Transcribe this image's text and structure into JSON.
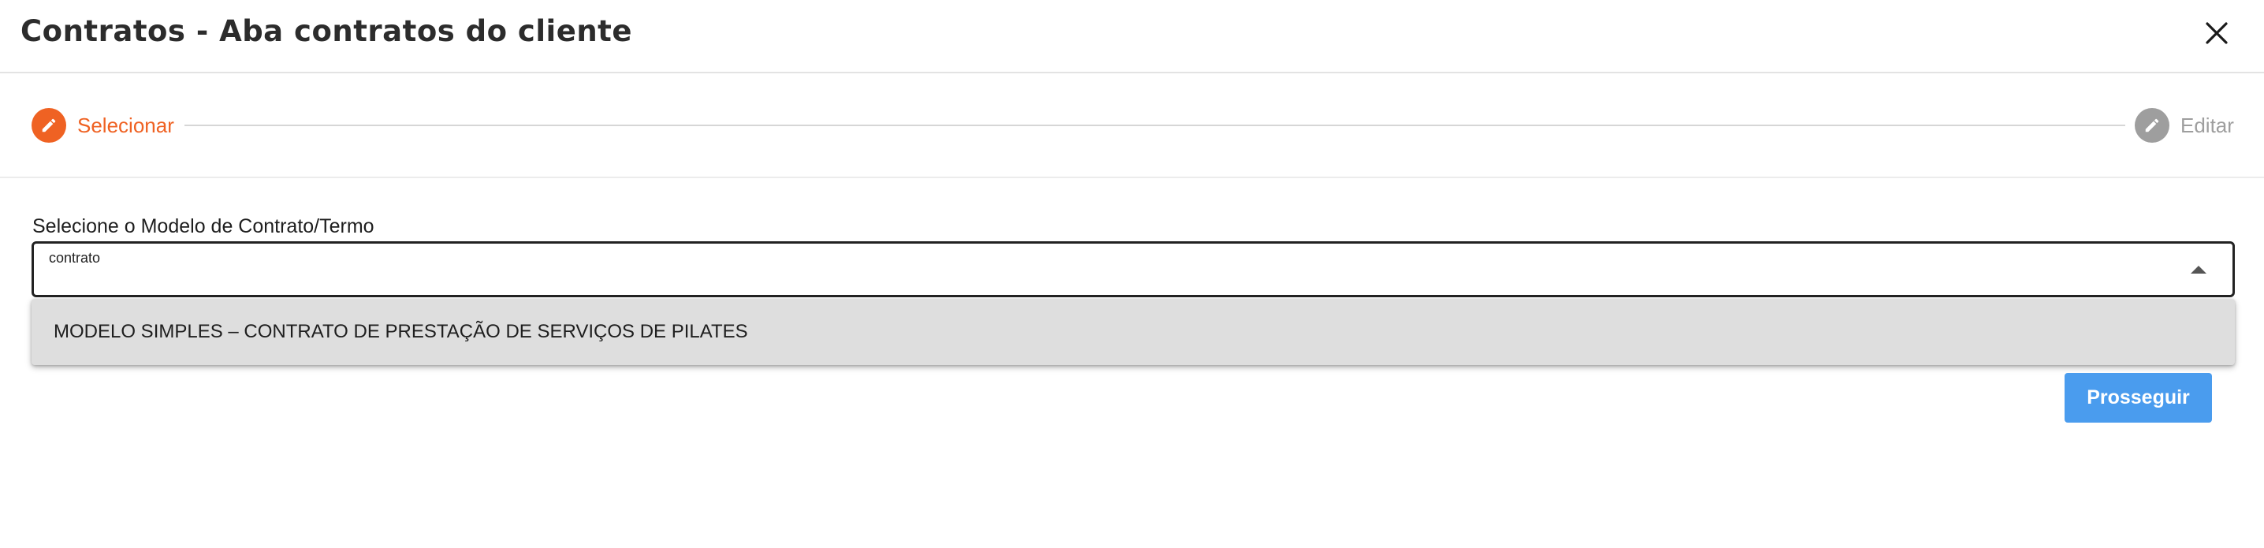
{
  "dialog": {
    "title": "Contratos - Aba contratos do cliente",
    "close_icon": "close-icon"
  },
  "stepper": {
    "steps": [
      {
        "label": "Selecionar",
        "icon": "pencil-icon",
        "state": "active",
        "color": "#ef6223"
      },
      {
        "label": "Editar",
        "icon": "pencil-icon",
        "state": "inactive",
        "color": "#9e9e9e"
      }
    ]
  },
  "form": {
    "field_label": "Selecione o Modelo de Contrato/Termo",
    "search_value": "contrato",
    "dropdown_icon": "caret-up-icon",
    "options": [
      "MODELO SIMPLES – CONTRATO DE PRESTAÇÃO DE SERVIÇOS DE PILATES"
    ]
  },
  "actions": {
    "proceed_label": "Prosseguir",
    "proceed_color": "#4a9cee"
  }
}
